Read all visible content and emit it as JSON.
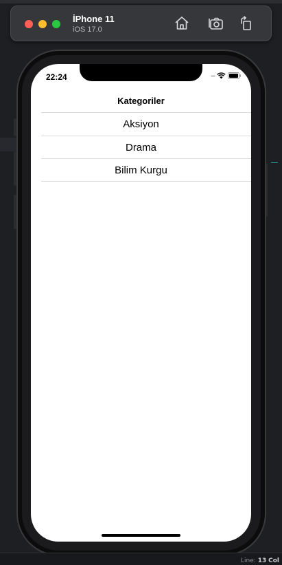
{
  "simulator": {
    "device_name": "İPhone 11",
    "os_version": "iOS 17.0",
    "icons": [
      "home-icon",
      "screenshot-icon",
      "rotate-icon"
    ]
  },
  "status_bar": {
    "time": "22:24",
    "icons": [
      "wifi-icon",
      "battery-icon"
    ]
  },
  "app": {
    "nav_title": "Kategoriler",
    "items": [
      "Aksiyon",
      "Drama",
      "Bilim Kurgu"
    ]
  },
  "editor_status": {
    "line_label": "Line:",
    "line_value": "13",
    "col_label": "Col"
  }
}
